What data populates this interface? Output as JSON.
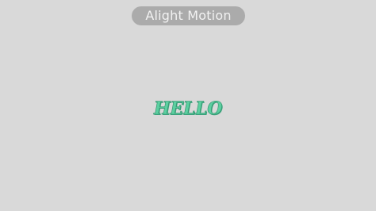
{
  "watermark": {
    "app_name": "Alight Motion"
  },
  "canvas": {
    "text": "HELLO",
    "text_color": "#5ccfa0",
    "background_color": "#d9d9d9"
  }
}
